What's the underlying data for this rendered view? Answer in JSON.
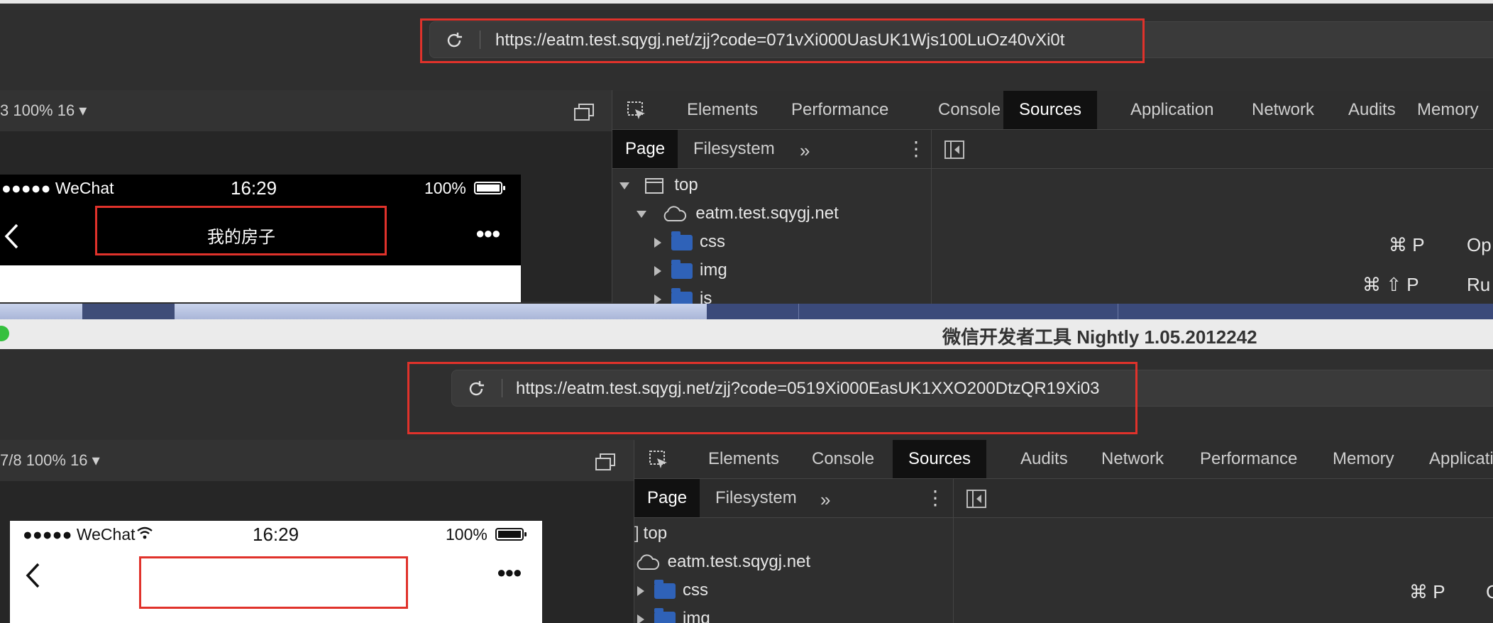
{
  "top": {
    "url": "https://eatm.test.sqygj.net/zjj?code=071vXi000UasUK1Wjs100LuOz40vXi0t",
    "device_info": "3 100% 16 ▾",
    "devtools_tabs": [
      "Elements",
      "Performance",
      "Console",
      "Sources",
      "Application",
      "Network",
      "Audits",
      "Memory"
    ],
    "active_tab": "Sources",
    "sub_tabs": [
      "Page",
      "Filesystem"
    ],
    "tree": {
      "root": "top",
      "domain": "eatm.test.sqygj.net",
      "folders": [
        "css",
        "img",
        "js"
      ]
    },
    "phone": {
      "carrier": "●●●●● WeChat",
      "time": "16:29",
      "battery": "100%",
      "title": "我的房子"
    },
    "shortcuts": [
      {
        "keys": "⌘ P",
        "label": "Op"
      },
      {
        "keys": "⌘ ⇧ P",
        "label": "Ru"
      }
    ]
  },
  "window_title": "微信开发者工具 Nightly 1.05.2012242",
  "bottom": {
    "url": "https://eatm.test.sqygj.net/zjj?code=0519Xi000EasUK1XXO200DtzQR19Xi03",
    "device_info": "7/8 100% 16 ▾",
    "devtools_tabs": [
      "Elements",
      "Console",
      "Sources",
      "Audits",
      "Network",
      "Performance",
      "Memory",
      "Application"
    ],
    "active_tab": "Sources",
    "sub_tabs": [
      "Page",
      "Filesystem"
    ],
    "tree": {
      "root": "top",
      "domain": "eatm.test.sqygj.net",
      "folders": [
        "css",
        "img"
      ]
    },
    "phone": {
      "carrier": "●●●●● WeChat",
      "time": "16:29",
      "battery": "100%",
      "title": ""
    },
    "shortcuts": [
      {
        "keys": "⌘ P",
        "label": "C"
      }
    ]
  },
  "colors": {
    "highlight": "#e0322b",
    "active_tab_bg": "#111111",
    "folder": "#2f62b8"
  }
}
